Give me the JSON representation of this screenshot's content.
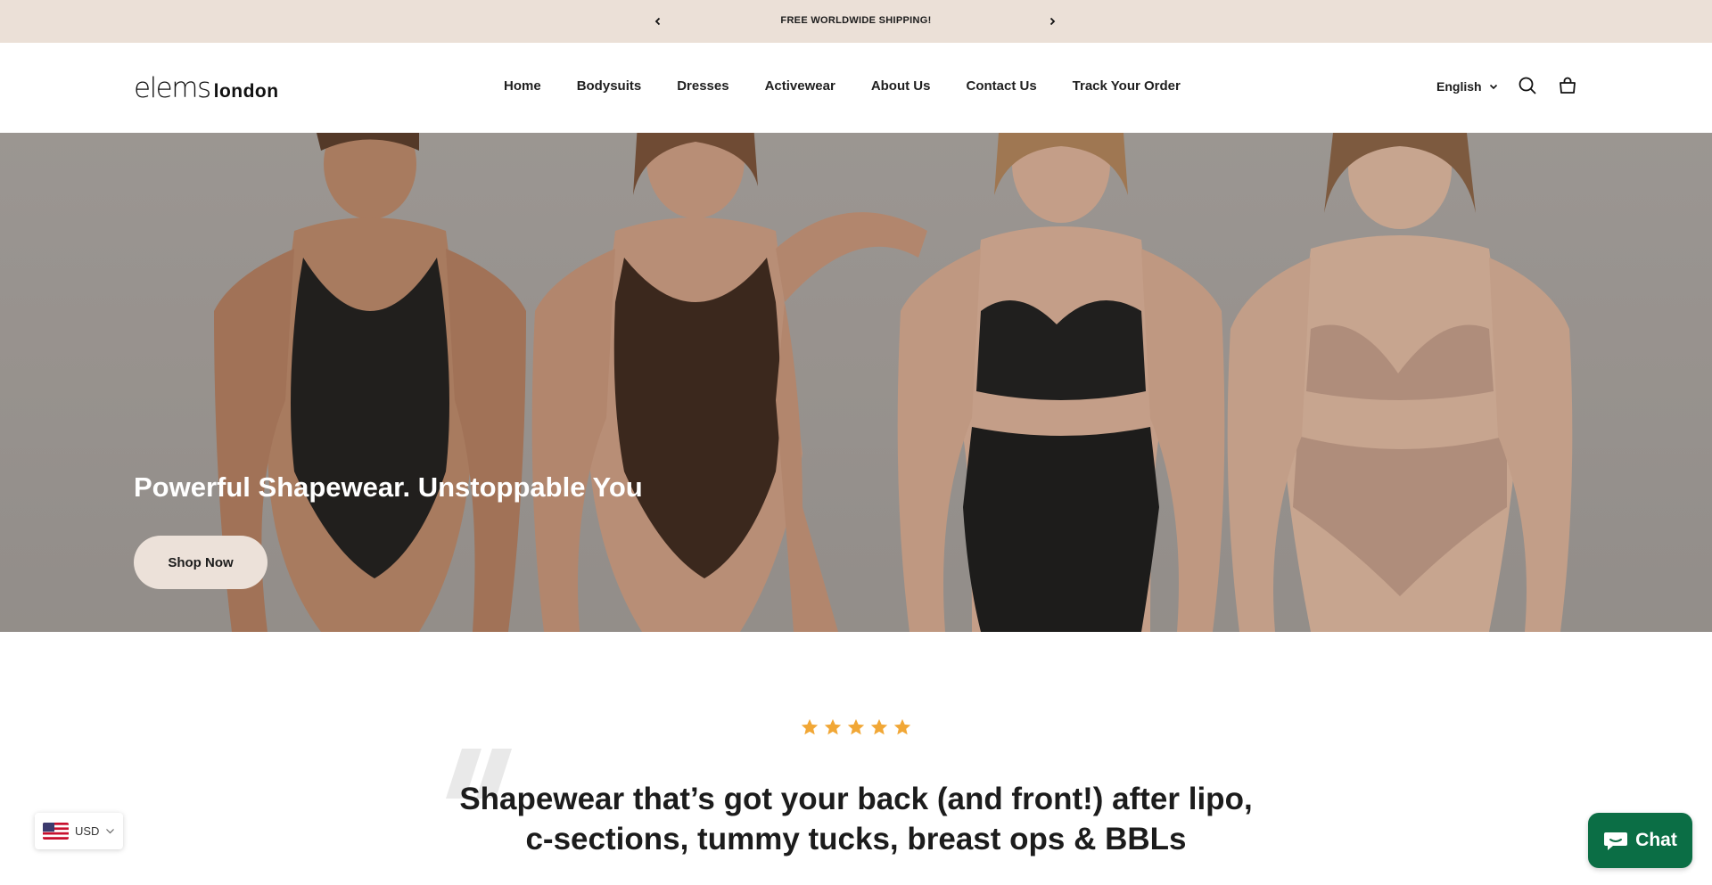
{
  "announcement": {
    "text": "FREE WORLDWIDE SHIPPING!",
    "prev_icon": "chevron-left-icon",
    "next_icon": "chevron-right-icon"
  },
  "header": {
    "logo_part1": "elems",
    "logo_part2": "london",
    "nav": [
      {
        "label": "Home"
      },
      {
        "label": "Bodysuits"
      },
      {
        "label": "Dresses"
      },
      {
        "label": "Activewear"
      },
      {
        "label": "About Us"
      },
      {
        "label": "Contact Us"
      },
      {
        "label": "Track Your Order"
      }
    ],
    "language": "English",
    "search_icon": "search-icon",
    "cart_icon": "cart-icon"
  },
  "hero": {
    "title": "Powerful Shapewear. Unstoppable You",
    "button_label": "Shop Now"
  },
  "testimonial": {
    "rating": 5,
    "text": "Shapewear that’s got your back (and front!) after lipo, c-sections, tummy tucks, breast ops & BBLs"
  },
  "currency": {
    "label": "USD",
    "flag_icon": "us-flag-icon"
  },
  "chat": {
    "label": "Chat",
    "icon": "chat-bubble-icon"
  },
  "colors": {
    "announcement_bg": "#ebe0d7",
    "button_bg": "#ece1d9",
    "star": "#f1a736",
    "chat_bg": "#0b6e45"
  }
}
